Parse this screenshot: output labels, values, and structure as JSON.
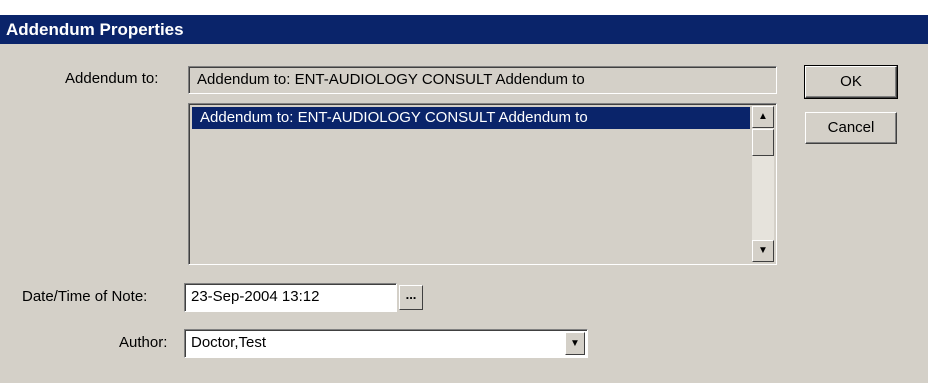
{
  "window": {
    "title": "Addendum Properties"
  },
  "addendum": {
    "label": "Addendum to:",
    "selected_text": "Addendum to: ENT-AUDIOLOGY CONSULT Addendum to",
    "list_items": [
      "Addendum to: ENT-AUDIOLOGY CONSULT Addendum to"
    ]
  },
  "buttons": {
    "ok": "OK",
    "cancel": "Cancel",
    "ellipsis": "..."
  },
  "datetime": {
    "label": "Date/Time of Note:",
    "value": "23-Sep-2004 13:12"
  },
  "author": {
    "label": "Author:",
    "value": "Doctor,Test"
  },
  "icons": {
    "scroll_up": "▲",
    "scroll_down": "▼",
    "dropdown": "▼"
  },
  "colors": {
    "titlebar": "#0a246a",
    "face": "#d4d0c8",
    "selection": "#0a246a"
  }
}
